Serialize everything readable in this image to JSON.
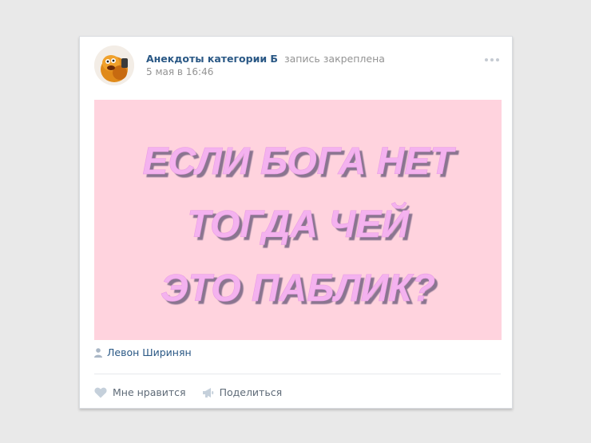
{
  "post": {
    "author": "Анекдоты категории Б",
    "pinned_label": "запись закреплена",
    "date": "5 мая в 16:46",
    "image_lines": [
      "ЕСЛИ БОГА НЕТ",
      "ТОГДА ЧЕЙ",
      "ЭТО ПАБЛИК?"
    ],
    "signer": "Левон Ширинян"
  },
  "actions": {
    "like_label": "Мне нравится",
    "share_label": "Поделиться"
  },
  "colors": {
    "link": "#2a5885",
    "muted": "#939393",
    "image_bg": "#ffd3de",
    "text_fill": "#f4b2ef",
    "text_shadow": "#8a7590"
  }
}
